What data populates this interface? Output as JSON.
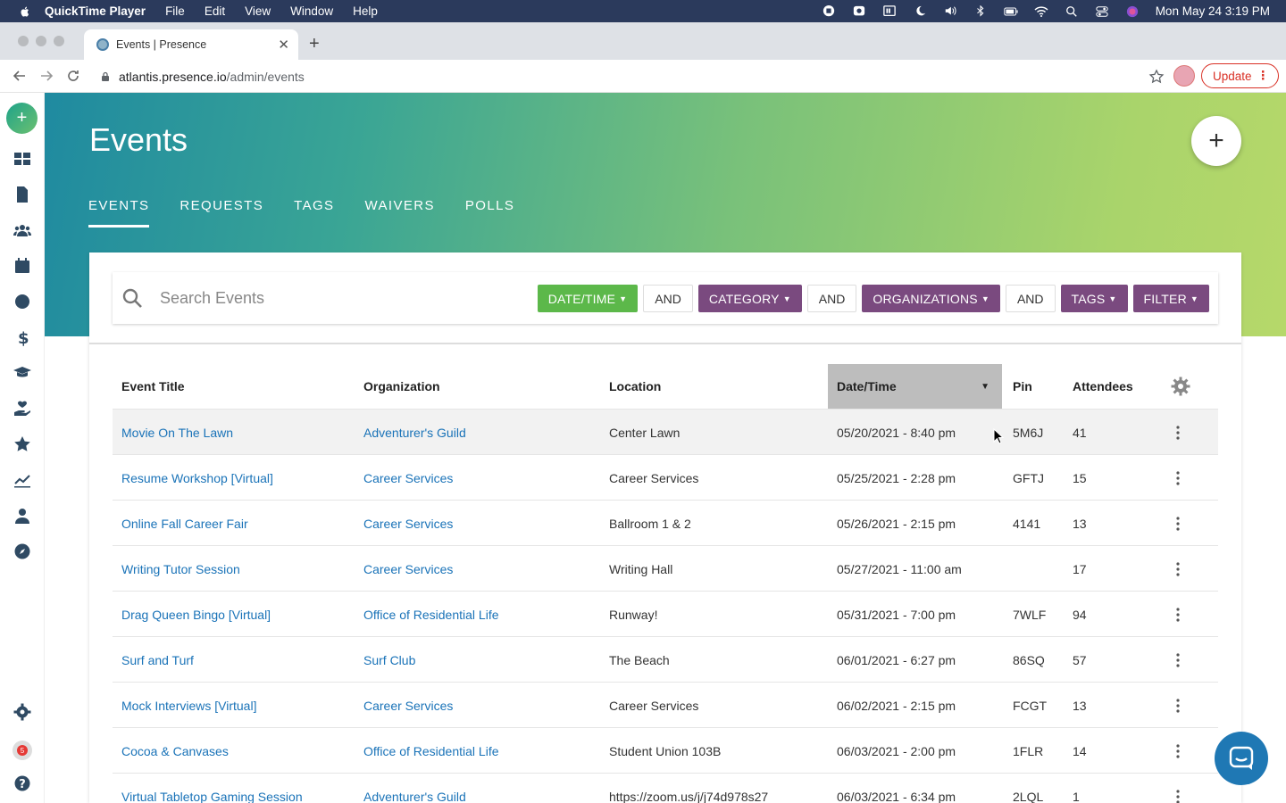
{
  "menubar": {
    "app": "QuickTime Player",
    "items": [
      "File",
      "Edit",
      "View",
      "Window",
      "Help"
    ],
    "datetime": "Mon May 24  3:19 PM"
  },
  "browser": {
    "tab_title": "Events | Presence",
    "url_host": "atlantis.presence.io",
    "url_path": "/admin/events",
    "update_label": "Update"
  },
  "leftnav": {
    "add_label": "+",
    "notification_count": "5",
    "icons": [
      "dashboard-icon",
      "document-icon",
      "users-icon",
      "calendar-icon",
      "globe-icon",
      "dollar-icon",
      "graduation-cap-icon",
      "hand-heart-icon",
      "star-icon",
      "analytics-icon",
      "person-icon",
      "compass-icon"
    ]
  },
  "header": {
    "title": "Events",
    "tabs": [
      {
        "label": "EVENTS",
        "active": true
      },
      {
        "label": "REQUESTS"
      },
      {
        "label": "TAGS"
      },
      {
        "label": "WAIVERS"
      },
      {
        "label": "POLLS"
      }
    ],
    "fab_label": "+"
  },
  "search": {
    "placeholder": "Search Events"
  },
  "filters": {
    "date_time": "DATE/TIME",
    "and1": "AND",
    "category": "CATEGORY",
    "and2": "AND",
    "organizations": "ORGANIZATIONS",
    "and3": "AND",
    "tags": "TAGS",
    "filter": "FILTER"
  },
  "colors": {
    "filter_green": "#5cb84a",
    "filter_purple": "#7a4a7f",
    "link_blue": "#1a73b8"
  },
  "table": {
    "columns": {
      "title": "Event Title",
      "organization": "Organization",
      "location": "Location",
      "datetime": "Date/Time",
      "pin": "Pin",
      "attendees": "Attendees"
    },
    "rows": [
      {
        "title": "Movie On The Lawn",
        "organization": "Adventurer's Guild",
        "location": "Center Lawn",
        "datetime": "05/20/2021 - 8:40 pm",
        "pin": "5M6J",
        "attendees": "41"
      },
      {
        "title": "Resume Workshop [Virtual]",
        "organization": "Career Services",
        "location": "Career Services",
        "datetime": "05/25/2021 - 2:28 pm",
        "pin": "GFTJ",
        "attendees": "15"
      },
      {
        "title": "Online Fall Career Fair",
        "organization": "Career Services",
        "location": "Ballroom 1 & 2",
        "datetime": "05/26/2021 - 2:15 pm",
        "pin": "4141",
        "attendees": "13"
      },
      {
        "title": "Writing Tutor Session",
        "organization": "Career Services",
        "location": "Writing Hall",
        "datetime": "05/27/2021 - 11:00 am",
        "pin": "",
        "attendees": "17"
      },
      {
        "title": "Drag Queen Bingo [Virtual]",
        "organization": "Office of Residential Life",
        "location": "Runway!",
        "datetime": "05/31/2021 - 7:00 pm",
        "pin": "7WLF",
        "attendees": "94"
      },
      {
        "title": "Surf and Turf",
        "organization": "Surf Club",
        "location": "The Beach",
        "datetime": "06/01/2021 - 6:27 pm",
        "pin": "86SQ",
        "attendees": "57"
      },
      {
        "title": "Mock Interviews [Virtual]",
        "organization": "Career Services",
        "location": "Career Services",
        "datetime": "06/02/2021 - 2:15 pm",
        "pin": "FCGT",
        "attendees": "13"
      },
      {
        "title": "Cocoa & Canvases",
        "organization": "Office of Residential Life",
        "location": "Student Union 103B",
        "datetime": "06/03/2021 - 2:00 pm",
        "pin": "1FLR",
        "attendees": "14"
      },
      {
        "title": "Virtual Tabletop Gaming Session",
        "organization": "Adventurer's Guild",
        "location": "https://zoom.us/j/j74d978s27",
        "datetime": "06/03/2021 - 6:34 pm",
        "pin": "2LQL",
        "attendees": "1"
      }
    ]
  }
}
